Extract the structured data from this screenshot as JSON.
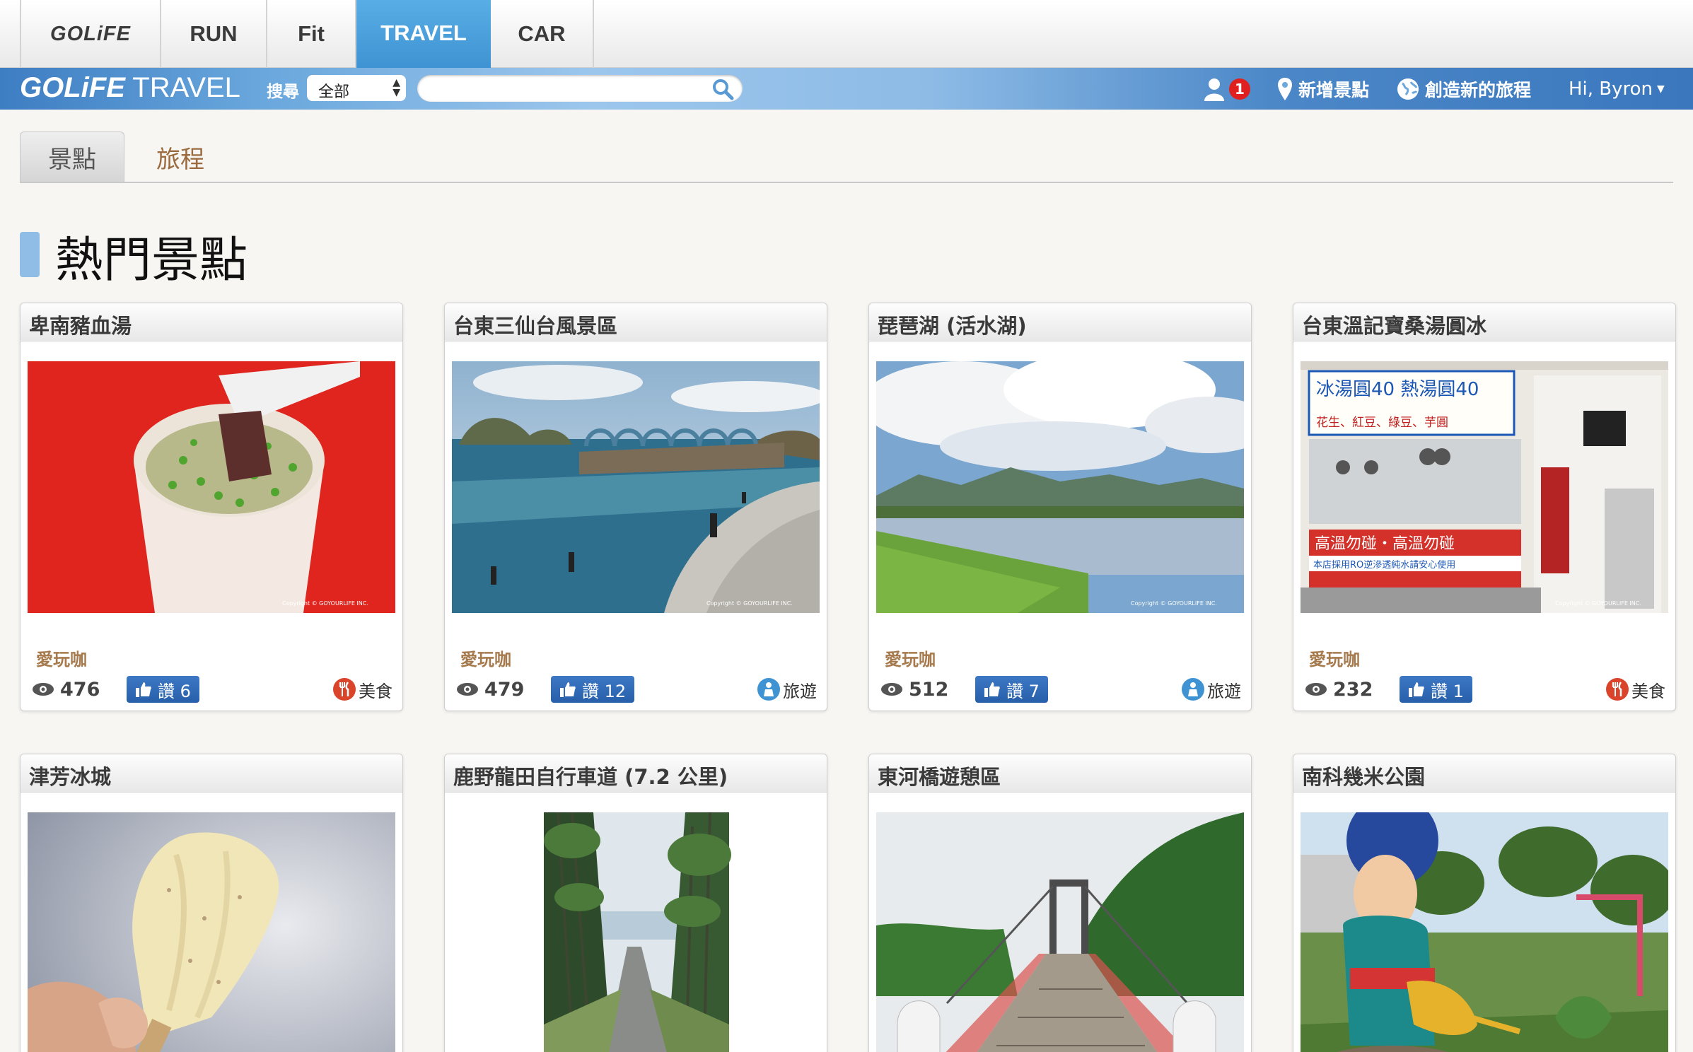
{
  "top_tabs": [
    "GOLiFE",
    "RUN",
    "Fit",
    "TRAVEL",
    "CAR"
  ],
  "brand": {
    "prefix": "GOLiFE",
    "suffix": " TRAVEL"
  },
  "search": {
    "label": "搜尋",
    "select_value": "全部",
    "input_value": ""
  },
  "nav": {
    "notification_count": "1",
    "add_spot": "新增景點",
    "create_trip": "創造新的旅程",
    "greeting": "Hi, Byron"
  },
  "sub_tabs": [
    "景點",
    "旅程"
  ],
  "section_title": "熱門景點",
  "cards": [
    {
      "title": "卑南豬血湯",
      "author": "愛玩咖",
      "views": "476",
      "likes": "讚 6",
      "category": "美食",
      "copyright": "Copyright © GOYOURLIFE INC."
    },
    {
      "title": "台東三仙台風景區",
      "author": "愛玩咖",
      "views": "479",
      "likes": "讚 12",
      "category": "旅遊",
      "copyright": "Copyright © GOYOURLIFE INC."
    },
    {
      "title": "琵琶湖 (活水湖)",
      "author": "愛玩咖",
      "views": "512",
      "likes": "讚 7",
      "category": "旅遊",
      "copyright": "Copyright © GOYOURLIFE INC."
    },
    {
      "title": "台東溫記寶桑湯圓冰",
      "author": "愛玩咖",
      "views": "232",
      "likes": "讚 1",
      "category": "美食",
      "copyright": "Copyright © GOYOURLIFE INC."
    },
    {
      "title": "津芳冰城"
    },
    {
      "title": "鹿野龍田自行車道 (7.2 公里)"
    },
    {
      "title": "東河橋遊憩區"
    },
    {
      "title": "南科幾米公園"
    }
  ],
  "shop_sign": {
    "line1": "冰湯圓40 熱湯圓40",
    "line2": "花生、紅豆、綠豆、芋圓",
    "line3": "高溫勿碰・高溫勿碰",
    "line4": "本店採用RO逆滲透純水請安心使用"
  },
  "colors": {
    "accent": "#3f93d2",
    "author": "#a67a4c",
    "like_button": "#2f69b5",
    "food_icon": "#d9442b",
    "travel_icon": "#3f93d2"
  }
}
